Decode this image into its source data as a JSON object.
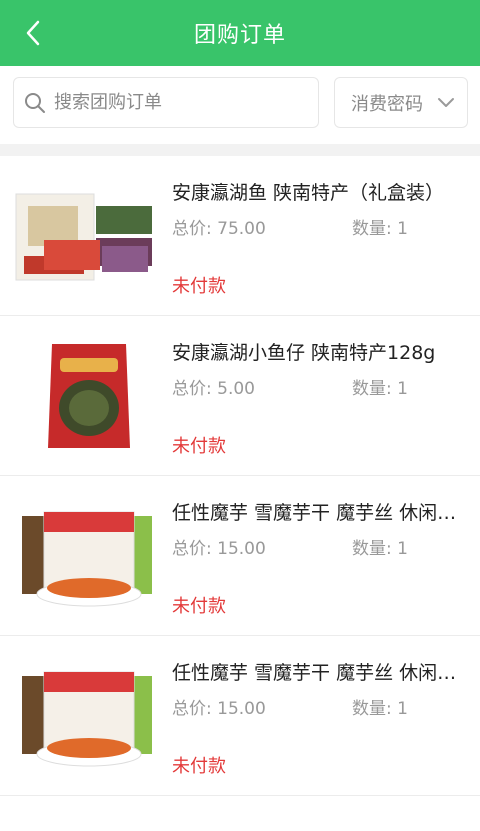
{
  "header": {
    "title": "团购订单"
  },
  "search": {
    "placeholder": "搜索团购订单"
  },
  "filter": {
    "label": "消费密码"
  },
  "orders": [
    {
      "title": "安康瀛湖鱼 陕南特产（礼盒装）",
      "price_label": "总价: 75.00",
      "qty_label": "数量: 1",
      "status": "未付款"
    },
    {
      "title": "安康瀛湖小鱼仔 陕南特产128g",
      "price_label": "总价: 5.00",
      "qty_label": "数量: 1",
      "status": "未付款"
    },
    {
      "title": "任性魔芋 雪魔芋干 魔芋丝 休闲零食",
      "price_label": "总价: 15.00",
      "qty_label": "数量: 1",
      "status": "未付款"
    },
    {
      "title": "任性魔芋 雪魔芋干 魔芋丝 休闲零食",
      "price_label": "总价: 15.00",
      "qty_label": "数量: 1",
      "status": "未付款"
    }
  ],
  "colors": {
    "header_bg": "#39c46a",
    "status_unpaid": "#e33a3a"
  }
}
